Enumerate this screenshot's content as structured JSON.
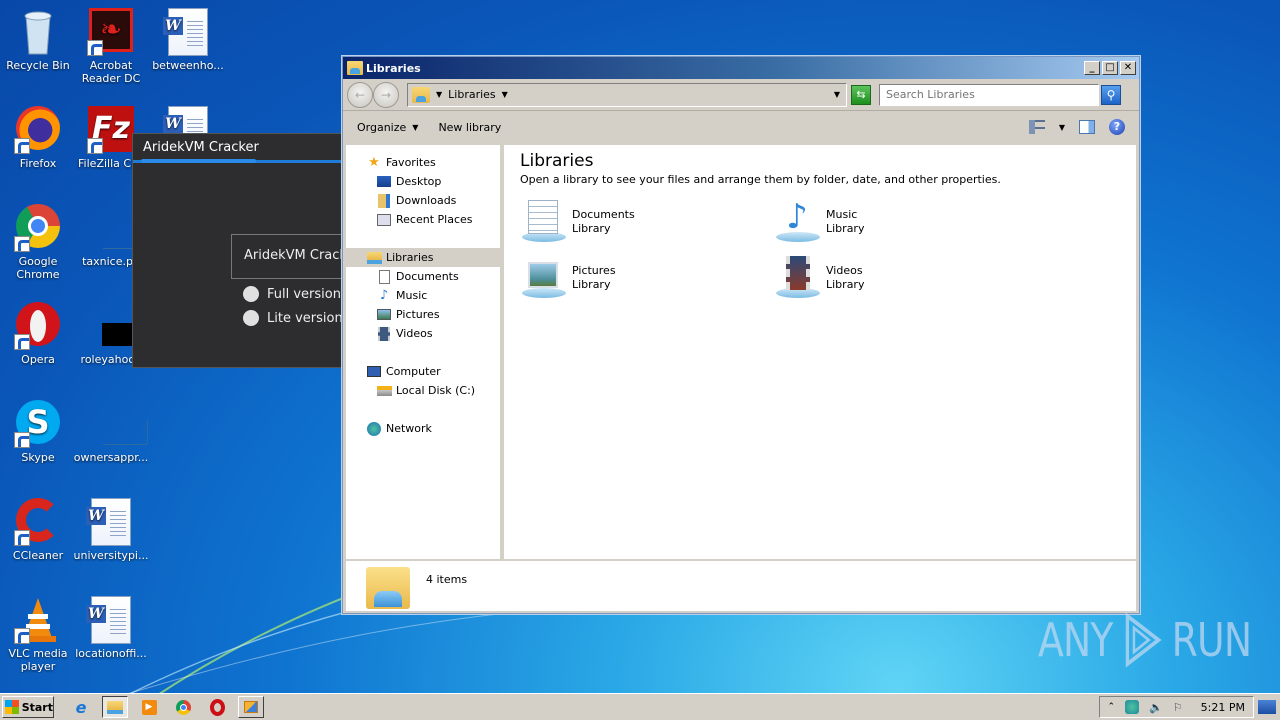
{
  "desktop": {
    "icons": [
      {
        "label": "Recycle Bin",
        "icon": "recycle-bin-icon"
      },
      {
        "label": "Acrobat Reader DC",
        "icon": "acrobat-icon"
      },
      {
        "label": "betweenho...",
        "icon": "word-doc-icon"
      },
      {
        "label": "Firefox",
        "icon": "firefox-icon"
      },
      {
        "label": "FileZilla Clie",
        "icon": "filezilla-icon"
      },
      {
        "label": "",
        "icon": "word-doc-icon"
      },
      {
        "label": "Google Chrome",
        "icon": "chrome-icon"
      },
      {
        "label": "taxnice.pn",
        "icon": "image-file-icon"
      },
      {
        "label": "Opera",
        "icon": "opera-icon"
      },
      {
        "label": "roleyahoo.j",
        "icon": "image-file-icon"
      },
      {
        "label": "Skype",
        "icon": "skype-icon"
      },
      {
        "label": "ownersappr...",
        "icon": "image-file-icon"
      },
      {
        "label": "CCleaner",
        "icon": "ccleaner-icon"
      },
      {
        "label": "universitypi...",
        "icon": "word-doc-icon"
      },
      {
        "label": "VLC media player",
        "icon": "vlc-icon"
      },
      {
        "label": "locationoffi...",
        "icon": "word-doc-icon"
      }
    ]
  },
  "cracker": {
    "title": "AridekVM Cracker",
    "group_label": "AridekVM Crack",
    "options": [
      "Full version",
      "Lite version"
    ]
  },
  "explorer": {
    "title": "Libraries",
    "address": {
      "crumb": "Libraries"
    },
    "search": {
      "placeholder": "Search Libraries"
    },
    "toolbar": {
      "organize": "Organize",
      "new_library": "New library"
    },
    "nav": {
      "favorites": "Favorites",
      "favorites_items": [
        "Desktop",
        "Downloads",
        "Recent Places"
      ],
      "libraries": "Libraries",
      "libraries_items": [
        "Documents",
        "Music",
        "Pictures",
        "Videos"
      ],
      "computer": "Computer",
      "computer_items": [
        "Local Disk (C:)"
      ],
      "network": "Network"
    },
    "content": {
      "heading": "Libraries",
      "description": "Open a library to see your files and arrange them by folder, date, and other properties.",
      "libraries": [
        {
          "name": "Documents",
          "type": "Library"
        },
        {
          "name": "Music",
          "type": "Library"
        },
        {
          "name": "Pictures",
          "type": "Library"
        },
        {
          "name": "Videos",
          "type": "Library"
        }
      ]
    },
    "status": {
      "count": "4 items"
    }
  },
  "taskbar": {
    "start": "Start",
    "clock": "5:21 PM"
  },
  "watermark": {
    "left": "ANY",
    "right": "RUN"
  }
}
